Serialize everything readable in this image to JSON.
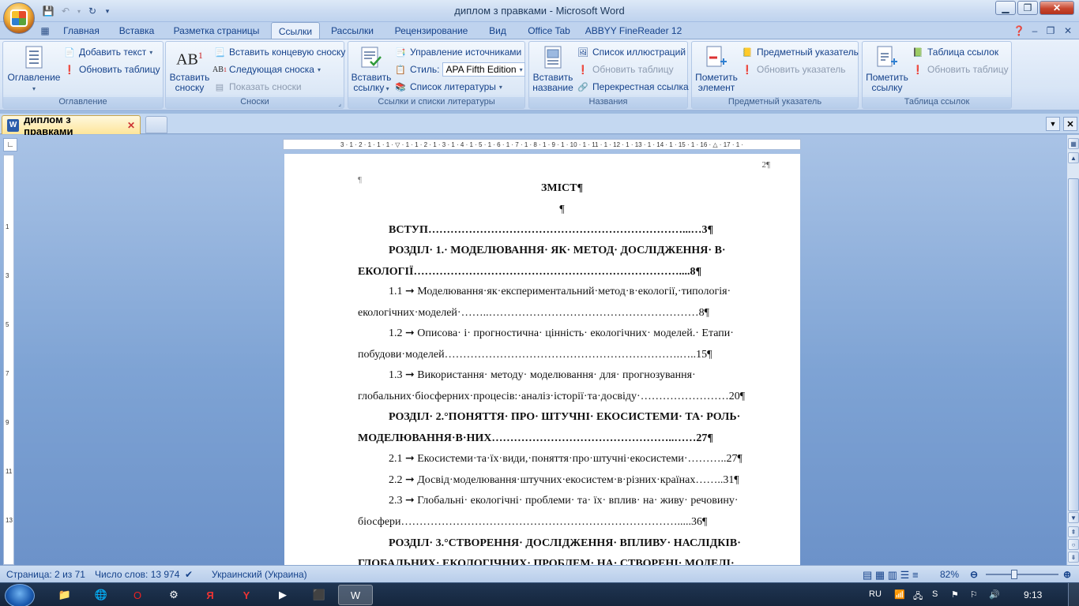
{
  "window": {
    "title": "диплом з правками - Microsoft Word"
  },
  "ribbon_tabs": [
    "Главная",
    "Вставка",
    "Разметка страницы",
    "Ссылки",
    "Рассылки",
    "Рецензирование",
    "Вид",
    "Office Tab",
    "ABBYY FineReader 12"
  ],
  "active_tab": "Ссылки",
  "groups": {
    "toc": {
      "title": "Оглавление",
      "big_button": "Оглавление",
      "add_text": "Добавить текст",
      "update_table": "Обновить таблицу"
    },
    "footnotes": {
      "title": "Сноски",
      "insert_footnote_line1": "Вставить",
      "insert_footnote_line2": "сноску",
      "insert_endnote": "Вставить концевую сноску",
      "next_footnote": "Следующая сноска",
      "show_notes": "Показать сноски"
    },
    "citations": {
      "title": "Ссылки и списки литературы",
      "insert_citation_line1": "Вставить",
      "insert_citation_line2": "ссылку",
      "manage_sources": "Управление источниками",
      "style_label": "Стиль:",
      "style_value": "APA Fifth Edition",
      "bibliography": "Список литературы"
    },
    "captions": {
      "title": "Названия",
      "insert_caption_line1": "Вставить",
      "insert_caption_line2": "название",
      "table_of_figures": "Список иллюстраций",
      "update_table": "Обновить таблицу",
      "cross_reference": "Перекрестная ссылка"
    },
    "index": {
      "title": "Предметный указатель",
      "mark_entry_line1": "Пометить",
      "mark_entry_line2": "элемент",
      "insert_index": "Предметный указатель",
      "update_index": "Обновить указатель"
    },
    "authorities": {
      "title": "Таблица ссылок",
      "mark_citation_line1": "Пометить",
      "mark_citation_line2": "ссылку",
      "table_of_authorities": "Таблица ссылок",
      "update_table": "Обновить таблицу"
    }
  },
  "document_tab": {
    "name": "диплом з правками"
  },
  "ruler": {
    "marks": "3 · 1 · 2 · 1 · 1 · 1 · ▽ · 1 · 1 · 2 · 1 · 3 · 1 · 4 · 1 · 5 · 1 · 6 · 1 · 7 · 1 · 8 · 1 · 9 · 1 · 10 · 1 · 11 · 1 · 12 · 1 · 13 · 1 · 14 · 1 · 15 · 1 · 16 · △ · 17 · 1 ·"
  },
  "document": {
    "page_number": "2¶",
    "pilcrow_top": "¶",
    "heading": "ЗМІСТ¶",
    "blank": "¶",
    "lines": [
      "ВСТУП……………………………………………………………...…3¶",
      "РОЗДІЛ· 1.· МОДЕЛЮВАННЯ· ЯК· МЕТОД· ДОСЛІДЖЕННЯ· В·",
      "ЕКОЛОГІЇ………………………………………………………………....8¶",
      "1.1 ➞ Моделювання·як·експериментальний·метод·в·екології,·типологія·",
      "екологічних·моделей·……..…………………………………………………8¶",
      "1.2 ➞ Описова· і· прогностична· цінність· екологічних· моделей.· Етапи·",
      "побудови·моделей……………………………………………………….…..15¶",
      "1.3 ➞ Використання· методу· моделювання· для· прогнозування·",
      "глобальних·біосферних·процесів:·аналіз·історії·та·досвіду·……………………20¶",
      "РОЗДІЛ· 2.°ПОНЯТТЯ· ПРО· ШТУЧНІ· ЕКОСИСТЕМИ· ТА· РОЛЬ·",
      "МОДЕЛЮВАННЯ·В·НИХ…………………………………………..……27¶",
      "2.1 ➞ Екосистеми·та·їх·види,·поняття·про·штучні·екосистеми·………..27¶",
      "2.2 ➞ Досвід·моделювання·штучних·екосистем·в·різних·країнах……..31¶",
      "2.3 ➞ Глобальні· екологічні· проблеми· та· їх· вплив· на· живу· речовину·",
      "біосфери………………………………………………………………….....36¶",
      "РОЗДІЛ· 3.°СТВОРЕННЯ· ДОСЛІДЖЕННЯ· ВПЛИВУ· НАСЛІДКІВ·",
      "ГЛОБАЛЬНИХ· ЕКОЛОГІЧНИХ· ПРОБЛЕМ· НА· СТВОРЕНІ· МОДЕЛІ·"
    ]
  },
  "statusbar": {
    "page": "Страница: 2 из 71",
    "words": "Число слов: 13 974",
    "language": "Украинский (Украина)",
    "zoom": "82%"
  },
  "taskbar": {
    "language": "RU",
    "time": "9:13"
  }
}
